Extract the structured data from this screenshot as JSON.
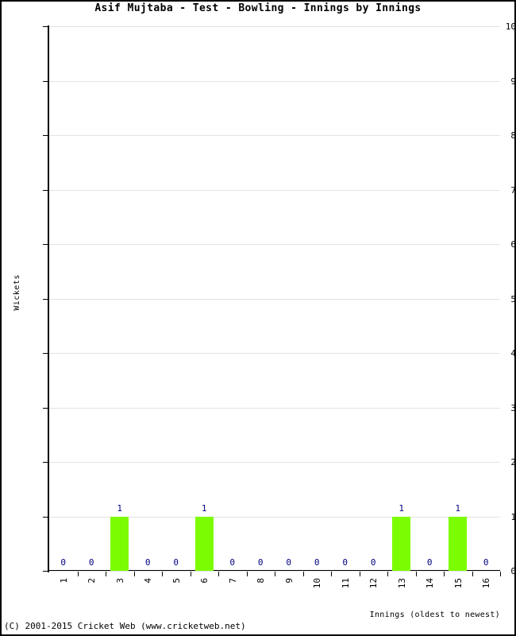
{
  "chart_data": {
    "type": "bar",
    "title": "Asif Mujtaba - Test - Bowling - Innings by Innings",
    "xlabel": "Innings (oldest to newest)",
    "ylabel": "Wickets",
    "categories": [
      "1",
      "2",
      "3",
      "4",
      "5",
      "6",
      "7",
      "8",
      "9",
      "10",
      "11",
      "12",
      "13",
      "14",
      "15",
      "16"
    ],
    "values": [
      0,
      0,
      1,
      0,
      0,
      1,
      0,
      0,
      0,
      0,
      0,
      0,
      1,
      0,
      1,
      0
    ],
    "value_labels": [
      "0",
      "0",
      "1",
      "0",
      "0",
      "1",
      "0",
      "0",
      "0",
      "0",
      "0",
      "0",
      "1",
      "0",
      "1",
      "0"
    ],
    "ylim": [
      0,
      10
    ],
    "y_ticks": [
      "0",
      "1",
      "2",
      "3",
      "4",
      "5",
      "6",
      "7",
      "8",
      "9",
      "10"
    ],
    "grid": true,
    "legend": "none",
    "bar_color": "#7CFC00",
    "value_label_color": "#000080",
    "grid_color": "#E3E3E3",
    "axis_color": "#000000"
  },
  "footer": {
    "copyright": "(C) 2001-2015 Cricket Web (www.cricketweb.net)"
  }
}
